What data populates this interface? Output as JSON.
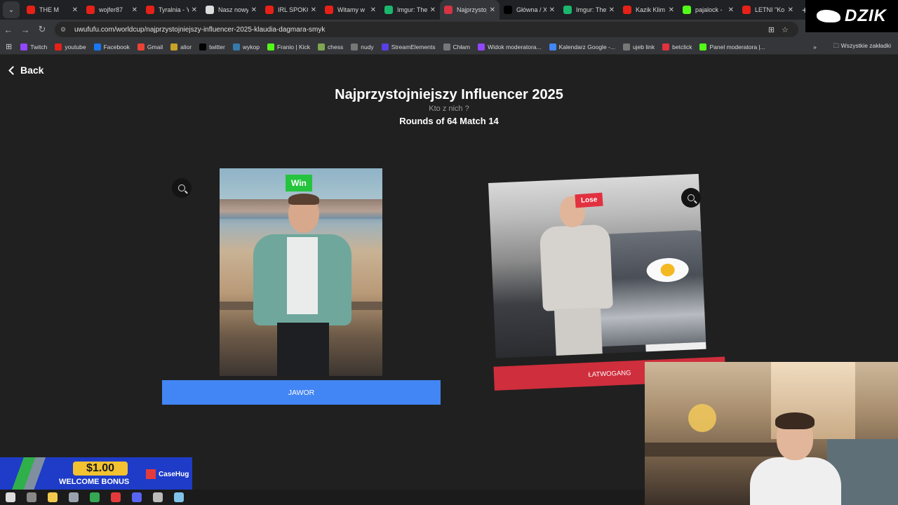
{
  "browser": {
    "tabs": [
      {
        "title": "THE M",
        "icon": "youtube-icon",
        "color": "#e62117"
      },
      {
        "title": "wojfer87",
        "icon": "youtube-icon",
        "color": "#e62117"
      },
      {
        "title": "Tyralnia - Y",
        "icon": "youtube-icon",
        "color": "#e62117"
      },
      {
        "title": "Nasz nowy",
        "icon": "google-icon",
        "color": "#dddddd"
      },
      {
        "title": "IRL SPOKO",
        "icon": "youtube-icon",
        "color": "#e62117"
      },
      {
        "title": "Witamy w",
        "icon": "youtube-icon",
        "color": "#e62117"
      },
      {
        "title": "Imgur: The",
        "icon": "imgur-icon",
        "color": "#1bb76e"
      },
      {
        "title": "Najprzystoj",
        "icon": "uwufufu-icon",
        "color": "#d63343",
        "active": true
      },
      {
        "title": "Główna / X",
        "icon": "x-icon",
        "color": "#000000"
      },
      {
        "title": "Imgur: The",
        "icon": "imgur-icon",
        "color": "#1bb76e"
      },
      {
        "title": "Kazik Klim",
        "icon": "youtube-icon",
        "color": "#e62117"
      },
      {
        "title": "pajalock -",
        "icon": "kick-icon",
        "color": "#53fc18"
      },
      {
        "title": "LETNI \"Ko",
        "icon": "youtube-icon",
        "color": "#e62117"
      }
    ],
    "url": "uwufufu.com/worldcup/najprzystojniejszy-influencer-2025-klaudia-dagmara-smyk",
    "bookmarks": [
      {
        "label": "Twitch",
        "color": "#9146ff"
      },
      {
        "label": "youtube",
        "color": "#e62117"
      },
      {
        "label": "Facebook",
        "color": "#1877f2"
      },
      {
        "label": "Gmail",
        "color": "#ea4335"
      },
      {
        "label": "alior",
        "color": "#c9a227"
      },
      {
        "label": "twitter",
        "color": "#000000"
      },
      {
        "label": "wykop",
        "color": "#367aa9"
      },
      {
        "label": "Franio | Kick",
        "color": "#53fc18"
      },
      {
        "label": "chess",
        "color": "#7fa650"
      },
      {
        "label": "nudy",
        "color": "#777777"
      },
      {
        "label": "StreamElements",
        "color": "#5b3ee6"
      },
      {
        "label": "Chłam",
        "color": "#777777"
      },
      {
        "label": "Widok moderatora...",
        "color": "#9146ff"
      },
      {
        "label": "Kalendarz Google -...",
        "color": "#4285f4"
      },
      {
        "label": "ujeb link",
        "color": "#777777"
      },
      {
        "label": "betclick",
        "color": "#e2313f"
      },
      {
        "label": "Panel moderatora |...",
        "color": "#53fc18"
      }
    ],
    "all_bookmarks": "Wszystkie zakładki"
  },
  "overlay_logo": "DZIK",
  "page": {
    "back_label": "Back",
    "title": "Najprzystojniejszy Influencer 2025",
    "subtitle": "Kto z nich ?",
    "round": "Rounds of 64 Match 14",
    "left": {
      "name": "JAWOR",
      "badge": "Win",
      "badge_color": "#25c43e",
      "button_color": "#4285f4"
    },
    "right": {
      "name": "ŁATWOGANG",
      "badge": "Lose",
      "badge_color": "#e2313f",
      "button_color": "#cf2e3c"
    }
  },
  "promo": {
    "amount": "$1.00",
    "text": "WELCOME BONUS",
    "brand": "CaseHug"
  }
}
